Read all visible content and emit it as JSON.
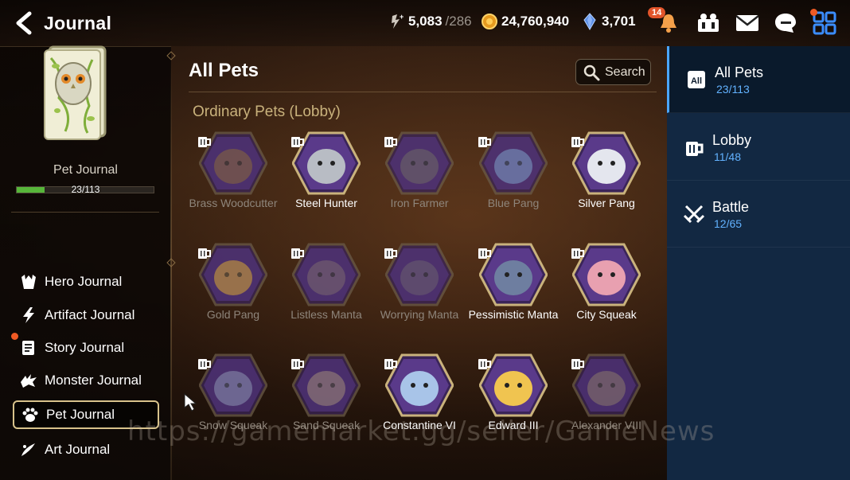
{
  "header": {
    "title": "Journal",
    "currencies": [
      {
        "icon": "stamina-icon",
        "value": "5,083",
        "sub": "/286"
      },
      {
        "icon": "gold-coin-icon",
        "value": "24,760,940",
        "sub": ""
      },
      {
        "icon": "crystal-icon",
        "value": "3,701",
        "sub": ""
      }
    ],
    "notification_count": "14"
  },
  "left": {
    "journal_name": "Pet Journal",
    "progress_text": "23/113",
    "progress_fraction": 0.2035,
    "nav": [
      {
        "label": "Hero Journal",
        "icon": "hero-icon"
      },
      {
        "label": "Artifact Journal",
        "icon": "artifact-icon"
      },
      {
        "label": "Story Journal",
        "icon": "story-icon"
      },
      {
        "label": "Monster Journal",
        "icon": "monster-icon"
      },
      {
        "label": "Pet Journal",
        "icon": "paw-icon"
      },
      {
        "label": "Art Journal",
        "icon": "art-icon"
      }
    ]
  },
  "main": {
    "title": "All Pets",
    "search_label": "Search",
    "section_title": "Ordinary Pets (Lobby)",
    "pets": [
      {
        "name": "Brass Woodcutter",
        "owned": false,
        "color": "#8a6a3a"
      },
      {
        "name": "Steel Hunter",
        "owned": true,
        "color": "#b8bcc4"
      },
      {
        "name": "Iron Farmer",
        "owned": false,
        "color": "#6f6a66"
      },
      {
        "name": "Blue Pang",
        "owned": false,
        "color": "#7ea0c8"
      },
      {
        "name": "Silver Pang",
        "owned": true,
        "color": "#e4e6ee"
      },
      {
        "name": "Gold Pang",
        "owned": false,
        "color": "#d9a832"
      },
      {
        "name": "Listless Manta",
        "owned": false,
        "color": "#7c6a70"
      },
      {
        "name": "Worrying Manta",
        "owned": false,
        "color": "#6c6070"
      },
      {
        "name": "Pessimistic Manta",
        "owned": true,
        "color": "#6e7ea0"
      },
      {
        "name": "City Squeak",
        "owned": true,
        "color": "#e8a0b0"
      },
      {
        "name": "Snow Squeak",
        "owned": false,
        "color": "#8c95b0"
      },
      {
        "name": "Sand Squeak",
        "owned": false,
        "color": "#a08c78"
      },
      {
        "name": "Constantine VI",
        "owned": true,
        "color": "#a8c4e8"
      },
      {
        "name": "Edward III",
        "owned": true,
        "color": "#f0c450"
      },
      {
        "name": "Alexander VIII",
        "owned": false,
        "color": "#8a7a6a"
      }
    ]
  },
  "right": {
    "categories": [
      {
        "name": "All Pets",
        "count": "23/113",
        "icon": "all-icon"
      },
      {
        "name": "Lobby",
        "count": "11/48",
        "icon": "mug-icon"
      },
      {
        "name": "Battle",
        "count": "12/65",
        "icon": "crossed-swords-icon"
      }
    ]
  },
  "watermark": "https://gamemarket.gg/seller/GameNews",
  "colors": {
    "accent_blue": "#4aa6ff",
    "progress_green": "#57b63a",
    "section_gold": "#c9b27c",
    "notification_orange": "#e2542a"
  }
}
